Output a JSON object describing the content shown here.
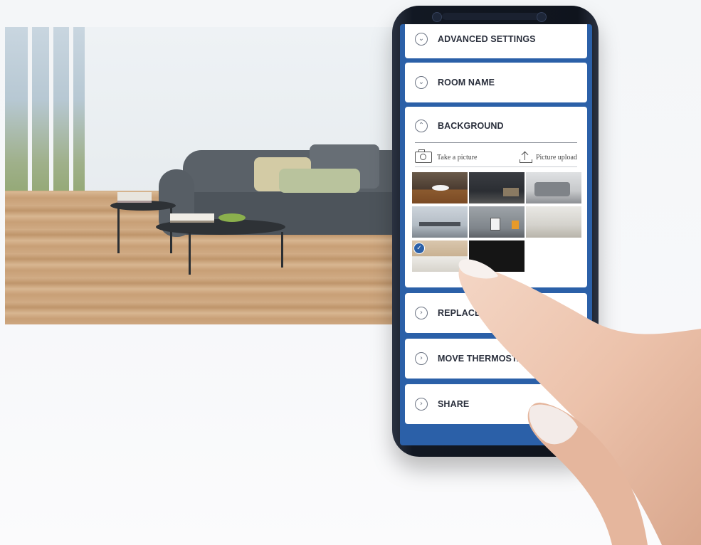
{
  "room_photo": {
    "alt": ""
  },
  "phone": {
    "menu": [
      {
        "title": "ADVANCED SETTINGS",
        "chevron": "chevron-down-icon"
      },
      {
        "title": "ROOM NAME",
        "chevron": "chevron-down-icon"
      },
      {
        "title": "BACKGROUND",
        "chevron": "chevron-up-icon"
      },
      {
        "title": "REPLACE THE",
        "chevron": "chevron-right-icon"
      },
      {
        "title": "MOVE THERMOSTAT",
        "chevron": "chevron-right-icon"
      },
      {
        "title": "SHARE",
        "chevron": "chevron-right-icon"
      }
    ],
    "background": {
      "take_picture_label": "Take a picture",
      "upload_label": "Picture upload",
      "selected_index": 6,
      "thumbnails": [
        "bathroom",
        "kitchen",
        "living-room-grey",
        "office",
        "thermostat-room",
        "white-hallway",
        "bedroom",
        "dark"
      ]
    },
    "colors": {
      "accent": "#2b60a8",
      "card": "#ffffff",
      "title": "#2a2f3c"
    }
  }
}
